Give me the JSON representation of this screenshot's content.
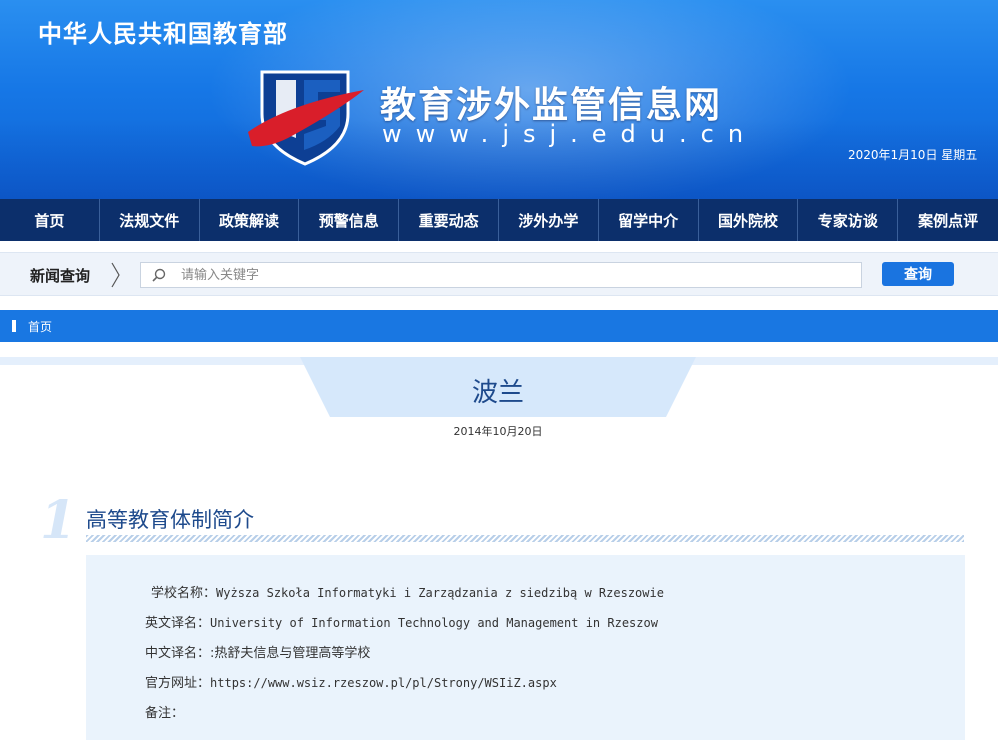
{
  "header": {
    "ministry": "中华人民共和国教育部",
    "site_name": "教育涉外监管信息网",
    "site_url": "www.jsj.edu.cn",
    "date": "2020年1月10日  星期五"
  },
  "nav": {
    "items": [
      "首页",
      "法规文件",
      "政策解读",
      "预警信息",
      "重要动态",
      "涉外办学",
      "留学中介",
      "国外院校",
      "专家访谈",
      "案例点评"
    ]
  },
  "search": {
    "label": "新闻查询",
    "placeholder": "请输入关键字",
    "button": "查询"
  },
  "breadcrumb": {
    "home": "首页"
  },
  "article": {
    "title": "波兰",
    "date": "2014年10月20日"
  },
  "section": {
    "number": "1",
    "title": "高等教育体制简介",
    "rows": [
      {
        "key": "学校名称：",
        "value": "Wyższa Szkoła Informatyki i Zarządzania z siedzibą w Rzeszowie"
      },
      {
        "key": "英文译名：",
        "value": "University of Information Technology and Management in Rzeszow"
      },
      {
        "key": "中文译名：",
        "value": ":热舒夫信息与管理高等学校"
      },
      {
        "key": "官方网址：",
        "value": "https://www.wsiz.rzeszow.pl/pl/Strony/WSIiZ.aspx"
      },
      {
        "key": "备注：",
        "value": ""
      }
    ]
  },
  "colors": {
    "banner": "#1677e6",
    "nav": "#0c2f6b",
    "accent": "#1977e2",
    "title_text": "#1e4a8c"
  }
}
